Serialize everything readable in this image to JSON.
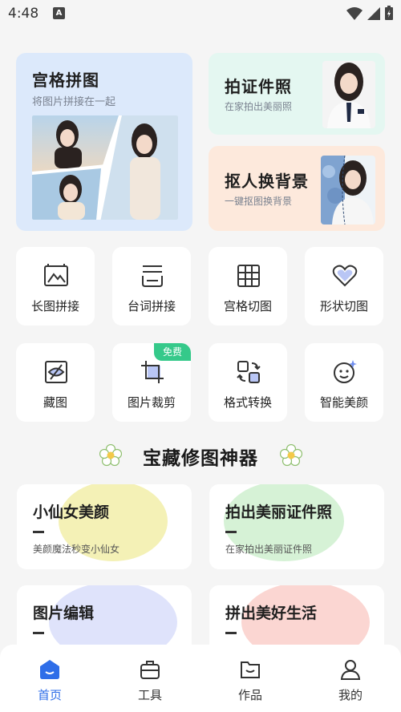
{
  "status": {
    "time": "4:48",
    "notif": "A"
  },
  "top_cards": {
    "grid": {
      "title": "宫格拼图",
      "subtitle": "将图片拼接在一起"
    },
    "id_photo": {
      "title": "拍证件照",
      "subtitle": "在家拍出美丽照"
    },
    "bg_change": {
      "title": "抠人换背景",
      "subtitle": "一键抠图换背景"
    }
  },
  "tools": [
    {
      "label": "长图拼接",
      "icon": "long-image-icon"
    },
    {
      "label": "台词拼接",
      "icon": "subtitle-stack-icon"
    },
    {
      "label": "宫格切图",
      "icon": "grid-cut-icon"
    },
    {
      "label": "形状切图",
      "icon": "heart-shape-icon"
    },
    {
      "label": "藏图",
      "icon": "hidden-eye-icon"
    },
    {
      "label": "图片裁剪",
      "icon": "crop-icon",
      "badge": "免费"
    },
    {
      "label": "格式转换",
      "icon": "convert-icon"
    },
    {
      "label": "智能美颜",
      "icon": "smile-sparkle-icon"
    }
  ],
  "section": {
    "title": "宝藏修图神器"
  },
  "features": [
    {
      "title": "小仙女美颜",
      "subtitle": "美颜魔法秒变小仙女",
      "color": "#f4f1b6"
    },
    {
      "title": "拍出美丽证件照",
      "subtitle": "在家拍出美丽证件照",
      "color": "#d6f2d6"
    },
    {
      "title": "图片编辑",
      "subtitle": "",
      "color": "#dfe3fb"
    },
    {
      "title": "拼出美好生活",
      "subtitle": "",
      "color": "#fbd6d2"
    }
  ],
  "nav": [
    {
      "label": "首页",
      "active": true
    },
    {
      "label": "工具",
      "active": false
    },
    {
      "label": "作品",
      "active": false
    },
    {
      "label": "我的",
      "active": false
    }
  ],
  "colors": {
    "accent": "#2f6ee8",
    "badge": "#35c98a"
  }
}
